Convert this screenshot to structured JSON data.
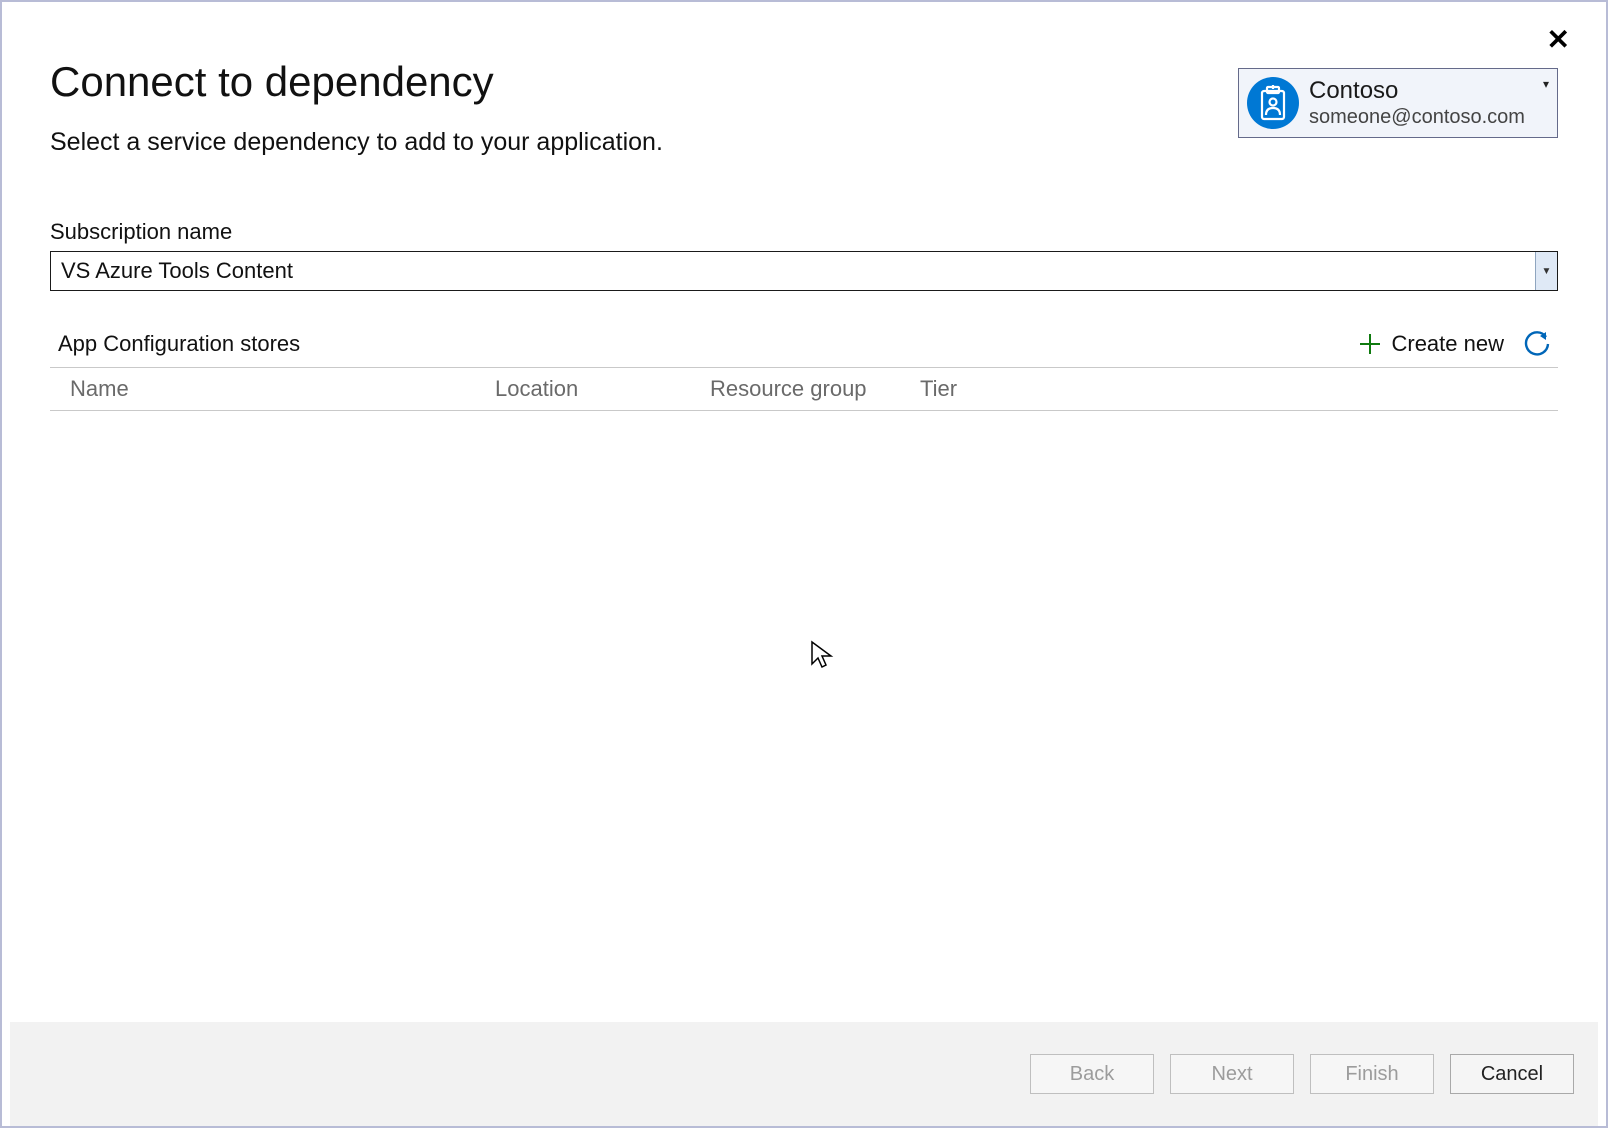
{
  "header": {
    "title": "Connect to dependency",
    "subtitle": "Select a service dependency to add to your application."
  },
  "account": {
    "name": "Contoso",
    "email": "someone@contoso.com"
  },
  "subscription": {
    "label": "Subscription name",
    "value": "VS Azure Tools Content"
  },
  "stores": {
    "title": "App Configuration stores",
    "create_new_label": "Create new",
    "columns": {
      "name": "Name",
      "location": "Location",
      "resource_group": "Resource group",
      "tier": "Tier"
    }
  },
  "footer": {
    "back": "Back",
    "next": "Next",
    "finish": "Finish",
    "cancel": "Cancel"
  }
}
